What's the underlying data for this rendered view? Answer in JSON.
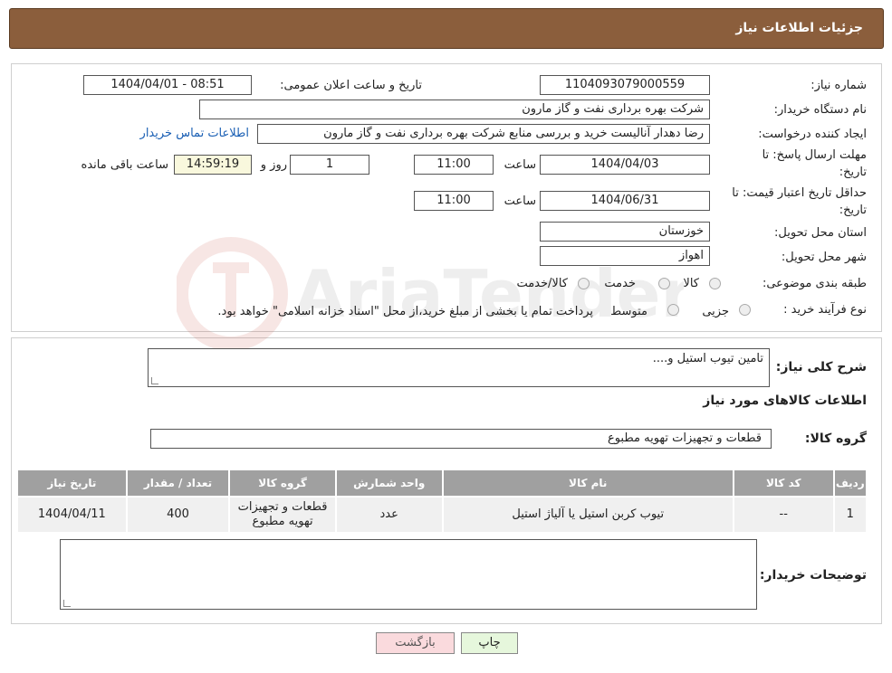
{
  "header": {
    "title": "جزئیات اطلاعات نیاز"
  },
  "details": {
    "need_number_label": "شماره نیاز:",
    "need_number": "1104093079000559",
    "announce_label": "تاریخ و ساعت اعلان عمومی:",
    "announce_value": "1404/04/01 - 08:51",
    "buyer_org_label": "نام دستگاه خریدار:",
    "buyer_org": "شرکت بهره برداری نفت و گاز مارون",
    "creator_label": "ایجاد کننده درخواست:",
    "creator": "رضا دهدار آنالیست خرید و بررسی منابع شرکت بهره برداری نفت و گاز مارون",
    "contact_link": "اطلاعات تماس خریدار",
    "deadline_label_1": "مهلت ارسال پاسخ: تا",
    "deadline_label_2": "تاریخ:",
    "deadline_date": "1404/04/03",
    "time_label": "ساعت",
    "deadline_time": "11:00",
    "days_value": "1",
    "days_label": "روز و",
    "remaining_time": "14:59:19",
    "remaining_label": "ساعت باقی مانده",
    "validity_label_1": "حداقل تاریخ اعتبار قیمت: تا",
    "validity_label_2": "تاریخ:",
    "validity_date": "1404/06/31",
    "validity_time": "11:00",
    "province_label": "استان محل تحویل:",
    "province": "خوزستان",
    "city_label": "شهر محل تحویل:",
    "city": "اهواز",
    "category_label": "طبقه بندی موضوعی:",
    "category_options": [
      "کالا",
      "خدمت",
      "کالا/خدمت"
    ],
    "purchase_type_label": "نوع فرآیند خرید :",
    "purchase_options": [
      "جزیی",
      "متوسط"
    ],
    "purchase_note": "پرداخت تمام یا بخشی از مبلغ خرید،از محل \"اسناد خزانه اسلامی\" خواهد بود."
  },
  "summary": {
    "description_label": "شرح کلی نیاز:",
    "description": "تامین تیوب استیل و....",
    "goods_info_title": "اطلاعات کالاهای مورد نیاز",
    "goods_group_label": "گروه کالا:",
    "goods_group": "قطعات و تجهیزات تهویه مطبوع"
  },
  "table": {
    "headers": [
      "ردیف",
      "کد کالا",
      "نام کالا",
      "واحد شمارش",
      "گروه کالا",
      "تعداد / مقدار",
      "تاریخ نیاز"
    ],
    "rows": [
      [
        "1",
        "--",
        "تیوب کربن استیل یا آلیاژ استیل",
        "عدد",
        "قطعات و تجهیزات تهویه مطبوع",
        "400",
        "1404/04/11"
      ]
    ]
  },
  "buyer_notes": {
    "label": "توضیحات خریدار:",
    "value": ""
  },
  "buttons": {
    "print": "چاپ",
    "back": "بازگشت"
  },
  "watermark": {
    "text": "AriaTender.neT"
  },
  "colors": {
    "header_bg": "#8b5e3c",
    "remaining_bg": "#f9f8dd",
    "link": "#1a5fb4",
    "back_btn_bg": "#fadadd",
    "print_btn_bg": "#e6f7dc"
  }
}
